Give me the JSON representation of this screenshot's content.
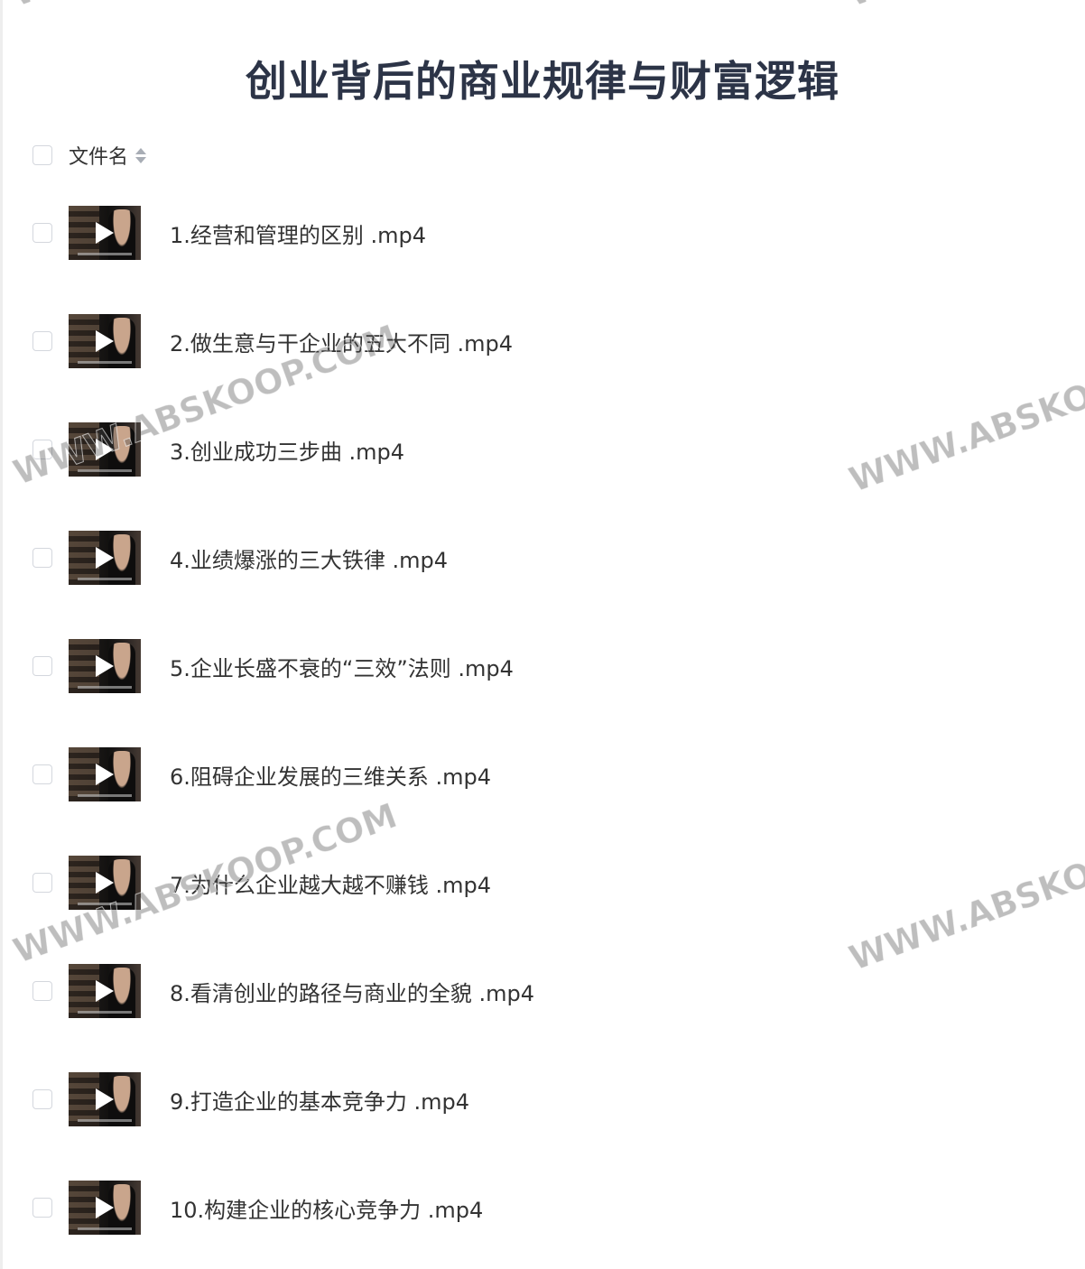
{
  "title": "创业背后的商业规律与财富逻辑",
  "header": {
    "column_label": "文件名",
    "sort_icon": "sort-up-down-icon"
  },
  "files": [
    {
      "name": "1.经营和管理的区别 .mp4"
    },
    {
      "name": "2.做生意与干企业的五大不同 .mp4"
    },
    {
      "name": "3.创业成功三步曲 .mp4"
    },
    {
      "name": "4.业绩爆涨的三大铁律 .mp4"
    },
    {
      "name": "5.企业长盛不衰的“三效”法则 .mp4"
    },
    {
      "name": "6.阻碍企业发展的三维关系 .mp4"
    },
    {
      "name": "7.为什么企业越大越不赚钱 .mp4"
    },
    {
      "name": "8.看清创业的路径与商业的全貌 .mp4"
    },
    {
      "name": "9.打造企业的基本竞争力 .mp4"
    },
    {
      "name": "10.构建企业的核心竞争力 .mp4"
    }
  ],
  "watermark": {
    "text": "WWW.ABSKOOP.COM",
    "fragment": "WWW.ABSKO",
    "top_fragment": "WW"
  }
}
